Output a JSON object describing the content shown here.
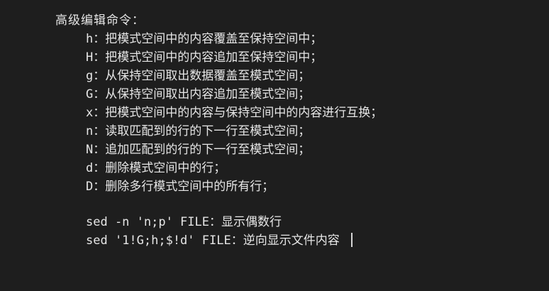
{
  "heading": "高级编辑命令：",
  "commands": [
    "h：把模式空间中的内容覆盖至保持空间中；",
    "H：把模式空间中的内容追加至保持空间中；",
    "g：从保持空间取出数据覆盖至模式空间；",
    "G：从保持空间取出内容追加至模式空间；",
    "x：把模式空间中的内容与保持空间中的内容进行互换；",
    "n：读取匹配到的行的下一行至模式空间；",
    "N：追加匹配到的行的下一行至模式空间；",
    "d：删除模式空间中的行；",
    "D：删除多行模式空间中的所有行；"
  ],
  "examples": [
    "sed -n 'n;p' FILE：显示偶数行",
    "sed '1!G;h;$!d' FILE：逆向显示文件内容"
  ],
  "colors": {
    "background": "#1e1e1e",
    "text": "#e6e6e6"
  }
}
